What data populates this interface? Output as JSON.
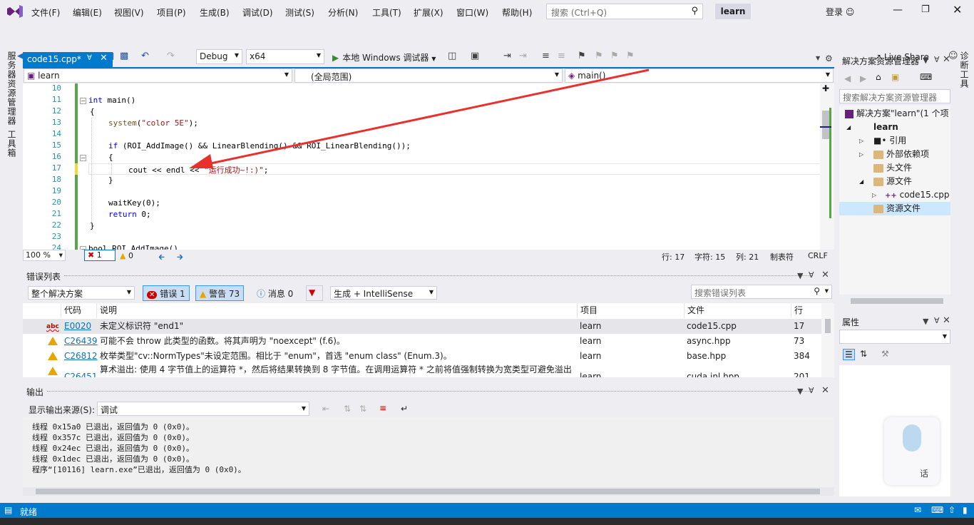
{
  "menu": {
    "items": [
      "文件(F)",
      "编辑(E)",
      "视图(V)",
      "项目(P)",
      "生成(B)",
      "调试(D)",
      "测试(S)",
      "分析(N)",
      "工具(T)",
      "扩展(X)",
      "窗口(W)",
      "帮助(H)"
    ],
    "search_placeholder": "搜索 (Ctrl+Q)",
    "project_name": "learn",
    "login": "登录"
  },
  "toolbar": {
    "config": "Debug",
    "platform": "x64",
    "run_label": "本地 Windows 调试器",
    "live_share": "Live Share"
  },
  "left_tabs": [
    "服务器资源管理器",
    "工具箱"
  ],
  "right_tabs": [
    "诊断工具"
  ],
  "editor": {
    "tab_title": "code15.cpp*",
    "nav_project": "learn",
    "nav_scope": "(全局范围)",
    "nav_member": "main()",
    "line_numbers": [
      "10",
      "11",
      "12",
      "13",
      "14",
      "15",
      "16",
      "17",
      "18",
      "19",
      "20",
      "21",
      "22",
      "23",
      "24"
    ],
    "code": {
      "l11_kw": "int",
      "l11_rest": " main()",
      "l12": "{",
      "l13_fn": "system",
      "l13_open": "(",
      "l13_str": "\"color 5E\"",
      "l13_close": ");",
      "l15_kw": "if",
      "l15_rest": " (ROI_AddImage() && LinearBlending() && ROI_LinearBlending());",
      "l16": "{",
      "l17_a": "cout << endl << ",
      "l17_str": "\"运行成功~!:)\"",
      "l17_end": ";",
      "l18": "}",
      "l20": "waitKey(0);",
      "l21_kw": "return",
      "l21_rest": " 0;",
      "l22": "}",
      "l24": "bool ROI_AddImage()"
    },
    "zoom": "100 %",
    "error_count": "1",
    "warning_count": "0",
    "status_line": "行: 17",
    "status_char": "字符: 15",
    "status_col": "列: 21",
    "status_tabs": "制表符",
    "status_eol": "CRLF"
  },
  "error_list": {
    "title": "错误列表",
    "scope": "整个解决方案",
    "errors_btn": "错误 1",
    "warnings_btn": "警告 73",
    "messages_btn": "消息 0",
    "source": "生成 + IntelliSense",
    "search_placeholder": "搜索错误列表",
    "headers": [
      "代码",
      "说明",
      "项目",
      "文件",
      "行"
    ],
    "rows": [
      {
        "code": "E0020",
        "desc": "未定义标识符 \"end1\"",
        "project": "learn",
        "file": "code15.cpp",
        "line": "17"
      },
      {
        "code": "C26439",
        "desc": "可能不会 throw 此类型的函数。将其声明为 \"noexcept\" (f.6)。",
        "project": "learn",
        "file": "async.hpp",
        "line": "73"
      },
      {
        "code": "C26812",
        "desc": "枚举类型\"cv::NormTypes\"未设定范围。相比于 \"enum\"，首选 \"enum class\" (Enum.3)。",
        "project": "learn",
        "file": "base.hpp",
        "line": "384"
      },
      {
        "code": "C26451",
        "desc": "算术溢出: 使用 4 字节值上的运算符 *，然后将结果转换到 8 字节值。在调用运算符 * 之前将值强制转换为宽类型可避免溢出",
        "project": "learn",
        "file": "cuda.inl.hpp",
        "line": "201"
      }
    ]
  },
  "output": {
    "title": "输出",
    "source_label": "显示输出来源(S):",
    "source_value": "调试",
    "lines": [
      "线程 0x15a0 已退出，返回值为 0 (0x0)。",
      "线程 0x357c 已退出，返回值为 0 (0x0)。",
      "线程 0x24ec 已退出，返回值为 0 (0x0)。",
      "线程 0x1dec 已退出，返回值为 0 (0x0)。",
      "程序“[10116] learn.exe”已退出，返回值为 0 (0x0)。"
    ]
  },
  "solution_explorer": {
    "title": "解决方案资源管理器",
    "search_placeholder": "搜索解决方案资源管理器",
    "tree": [
      "解决方案\"learn\"(1 个项",
      "learn",
      "引用",
      "外部依赖项",
      "头文件",
      "源文件",
      "code15.cpp",
      "资源文件"
    ]
  },
  "properties": {
    "title": "属性"
  },
  "status": {
    "text": "就绪"
  },
  "speech": {
    "label": "话"
  },
  "colors": {
    "accent": "#007acc",
    "annotation_arrow": "#e8302c",
    "change_bar": "#57a64a"
  }
}
